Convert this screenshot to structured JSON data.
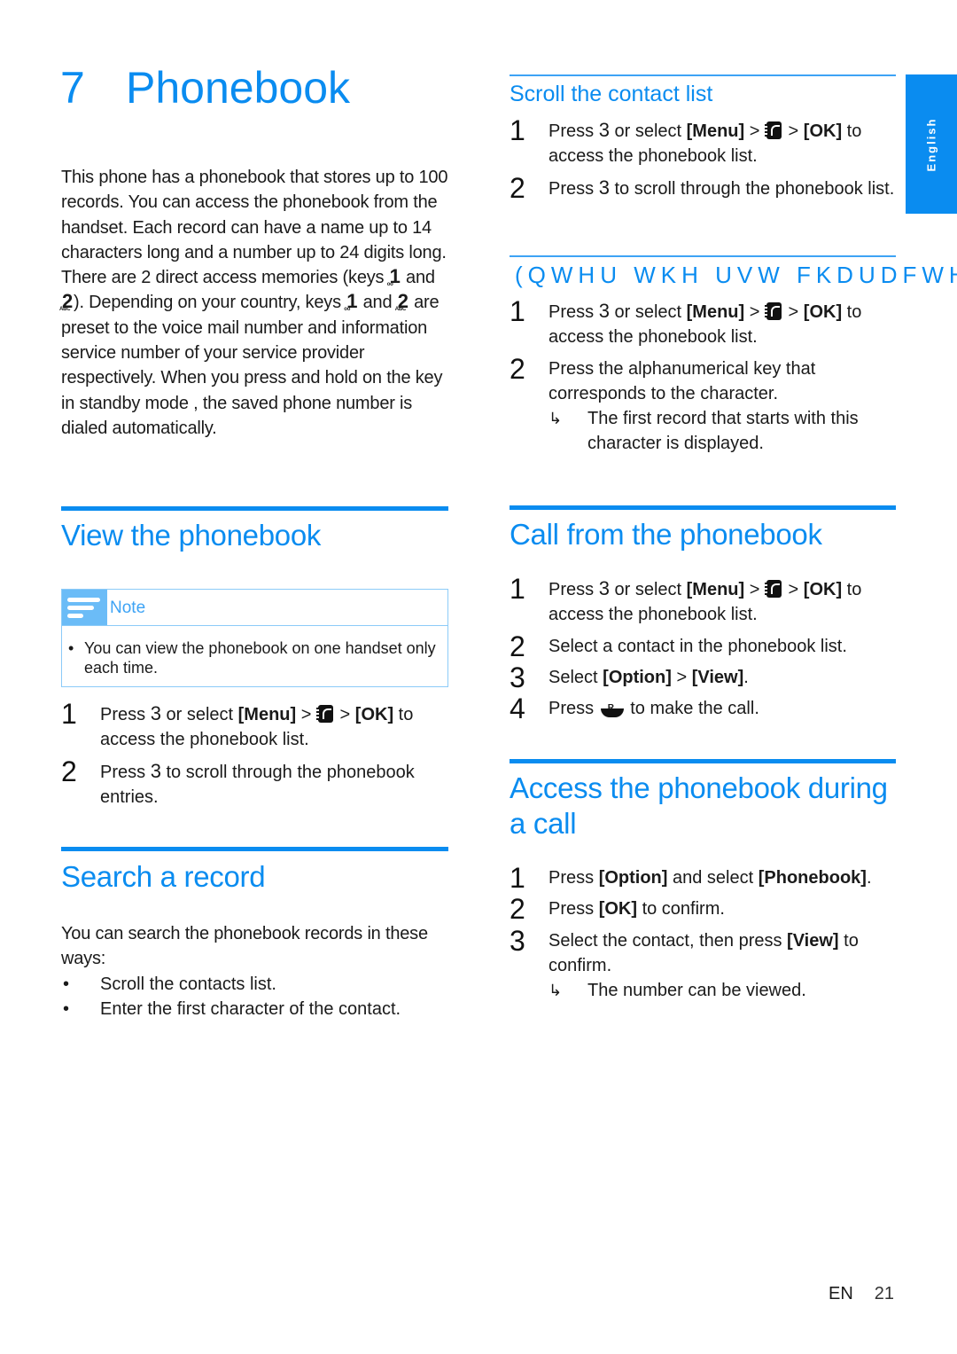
{
  "chapter": {
    "number": "7",
    "title": "Phonebook"
  },
  "side_tab": "English",
  "intro": {
    "p1": "This phone has a phonebook that stores up to 100 records. You can access the phonebook from the handset. Each record can have a name up to 14 characters long and a number up to 24 digits long.",
    "p2_a": "There are 2 direct access memories (keys ",
    "p2_b": " and ",
    "p2_c": "). Depending on your country, keys ",
    "p2_d": " and ",
    "p2_e": " are preset to the voice mail number and information service number of your service provider respectively. When you press and hold on the key in standby mode , the saved phone number is dialed automatically.",
    "key1": "1",
    "key2": "2",
    "key2_sub": "ABC"
  },
  "view_phonebook": {
    "heading": "View the phonebook",
    "note_label": "Note",
    "note_text": "You can view the phonebook on one handset only each time.",
    "steps": [
      {
        "num": "1",
        "a": "Press ",
        "b": "3",
        "c": " or select ",
        "d": "[Menu]",
        "e": "  > ",
        "f": " > ",
        "g": "[OK]",
        "h": " to access the phonebook list."
      },
      {
        "num": "2",
        "a": "Press ",
        "b": "3",
        "c": " to scroll through the phonebook entries."
      }
    ]
  },
  "search_record": {
    "heading": "Search a record",
    "intro": "You can search the phonebook records in these ways:",
    "bullets": [
      "Scroll the contacts list.",
      "Enter the first character of the contact."
    ]
  },
  "scroll_contact": {
    "heading": "Scroll the contact list",
    "steps": [
      {
        "num": "1",
        "a": "Press ",
        "b": "3",
        "c": " or select  ",
        "d": "[Menu]",
        "e": " > ",
        "f": " > ",
        "g": "[OK]",
        "h": " to access the phonebook list."
      },
      {
        "num": "2",
        "a": "Press ",
        "b": "3",
        "c": " to scroll through the phonebook list."
      }
    ]
  },
  "enter_first_char": {
    "heading": "(QWHU WKH  UVW FKDUDFWHU",
    "steps": [
      {
        "num": "1",
        "a": "Press ",
        "b": "3",
        "c": " or select ",
        "d": "[Menu]",
        "e": "  > ",
        "f": " > ",
        "g": "[OK]",
        "h": " to access the phonebook list."
      },
      {
        "num": "2",
        "text": "Press the alphanumerical key that corresponds to the character.",
        "result": "The first record that starts with this character is displayed."
      }
    ]
  },
  "call_from_phonebook": {
    "heading": "Call from the phonebook",
    "steps": [
      {
        "num": "1",
        "a": "Press ",
        "b": "3",
        "c": " or select  ",
        "d": "[Menu]",
        "e": " > ",
        "f": " > ",
        "g": "[OK]",
        "h": " to access the phonebook list."
      },
      {
        "num": "2",
        "text": "Select a contact in the phonebook list."
      },
      {
        "num": "3",
        "a": "Select ",
        "b": "[Option]",
        "c": " > ",
        "d": "[View]",
        "e": "."
      },
      {
        "num": "4",
        "a": "Press ",
        "icon_label": "R",
        "b": " to make the call."
      }
    ]
  },
  "access_during_call": {
    "heading": "Access the phonebook during a call",
    "steps": [
      {
        "num": "1",
        "a": "Press ",
        "b": "[Option]",
        "c": " and select ",
        "d": "[Phonebook]",
        "e": "."
      },
      {
        "num": "2",
        "a": "Press ",
        "b": "[OK]",
        "c": " to confirm."
      },
      {
        "num": "3",
        "a": "Select the contact, then press ",
        "b": "[View]",
        "c": " to confirm.",
        "result": "The number can be viewed."
      }
    ]
  },
  "footer": {
    "lang": "EN",
    "page": "21"
  },
  "result_arrow": "↳"
}
